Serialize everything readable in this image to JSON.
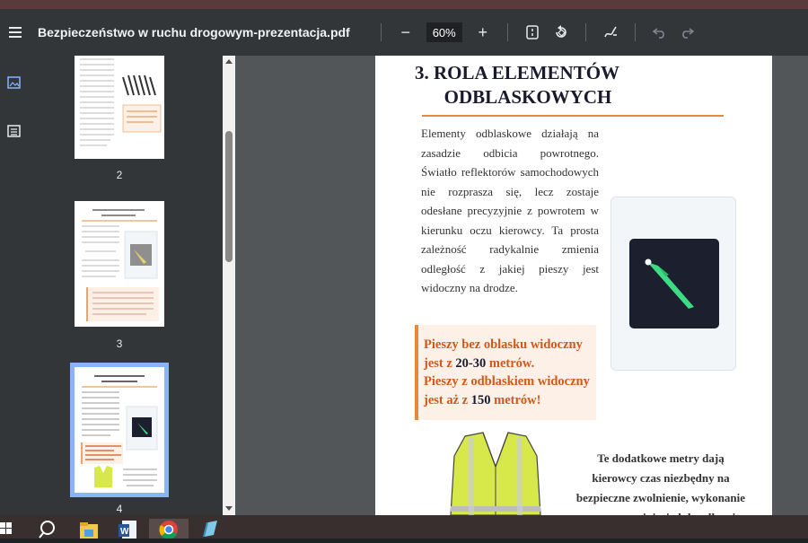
{
  "toolbar": {
    "title": "Bezpieczeństwo w ruchu drogowym-prezentacja.pdf",
    "zoom": "60%",
    "zoom_out": "−",
    "zoom_in": "+"
  },
  "thumbnails": [
    {
      "number": "2"
    },
    {
      "number": "3"
    },
    {
      "number": "4",
      "selected": true
    }
  ],
  "slide": {
    "title_line1": "3. ROLA ELEMENTÓW",
    "title_line2": "ODBLASKOWYCH",
    "body_lines": [
      "Elementy odblaskowe działają na",
      "zasadzie odbicia powrotnego.",
      "Światło reflektorów samochodowych",
      "nie rozprasza się, lecz zostaje",
      "odesłane precyzyjnie z powrotem w",
      "kierunku oczu kierowcy. Ta prosta",
      "zależność radykalnie zmienia",
      "odległość z jakiej pieszy jest",
      "widoczny na drodze."
    ],
    "callout": {
      "line1": "Pieszy bez oblasku widoczny",
      "line2_a": "jest z ",
      "line2_num": "20-30",
      "line2_b": " metrów.",
      "line3": "Pieszy z odblaskiem widoczny",
      "line4_a": "jest aż z ",
      "line4_num": "150",
      "line4_b": " metrów!"
    },
    "bold_lines": [
      "Te dodatkowe metry dają",
      "kierowcy czas niezbędny na",
      "bezpieczne zwolnienie, wykonanie",
      "manewru ominięcia lub całkowite"
    ]
  },
  "colors": {
    "accent": "#e8883a",
    "callout_text": "#d0591b",
    "vest": "#d7e84a"
  }
}
